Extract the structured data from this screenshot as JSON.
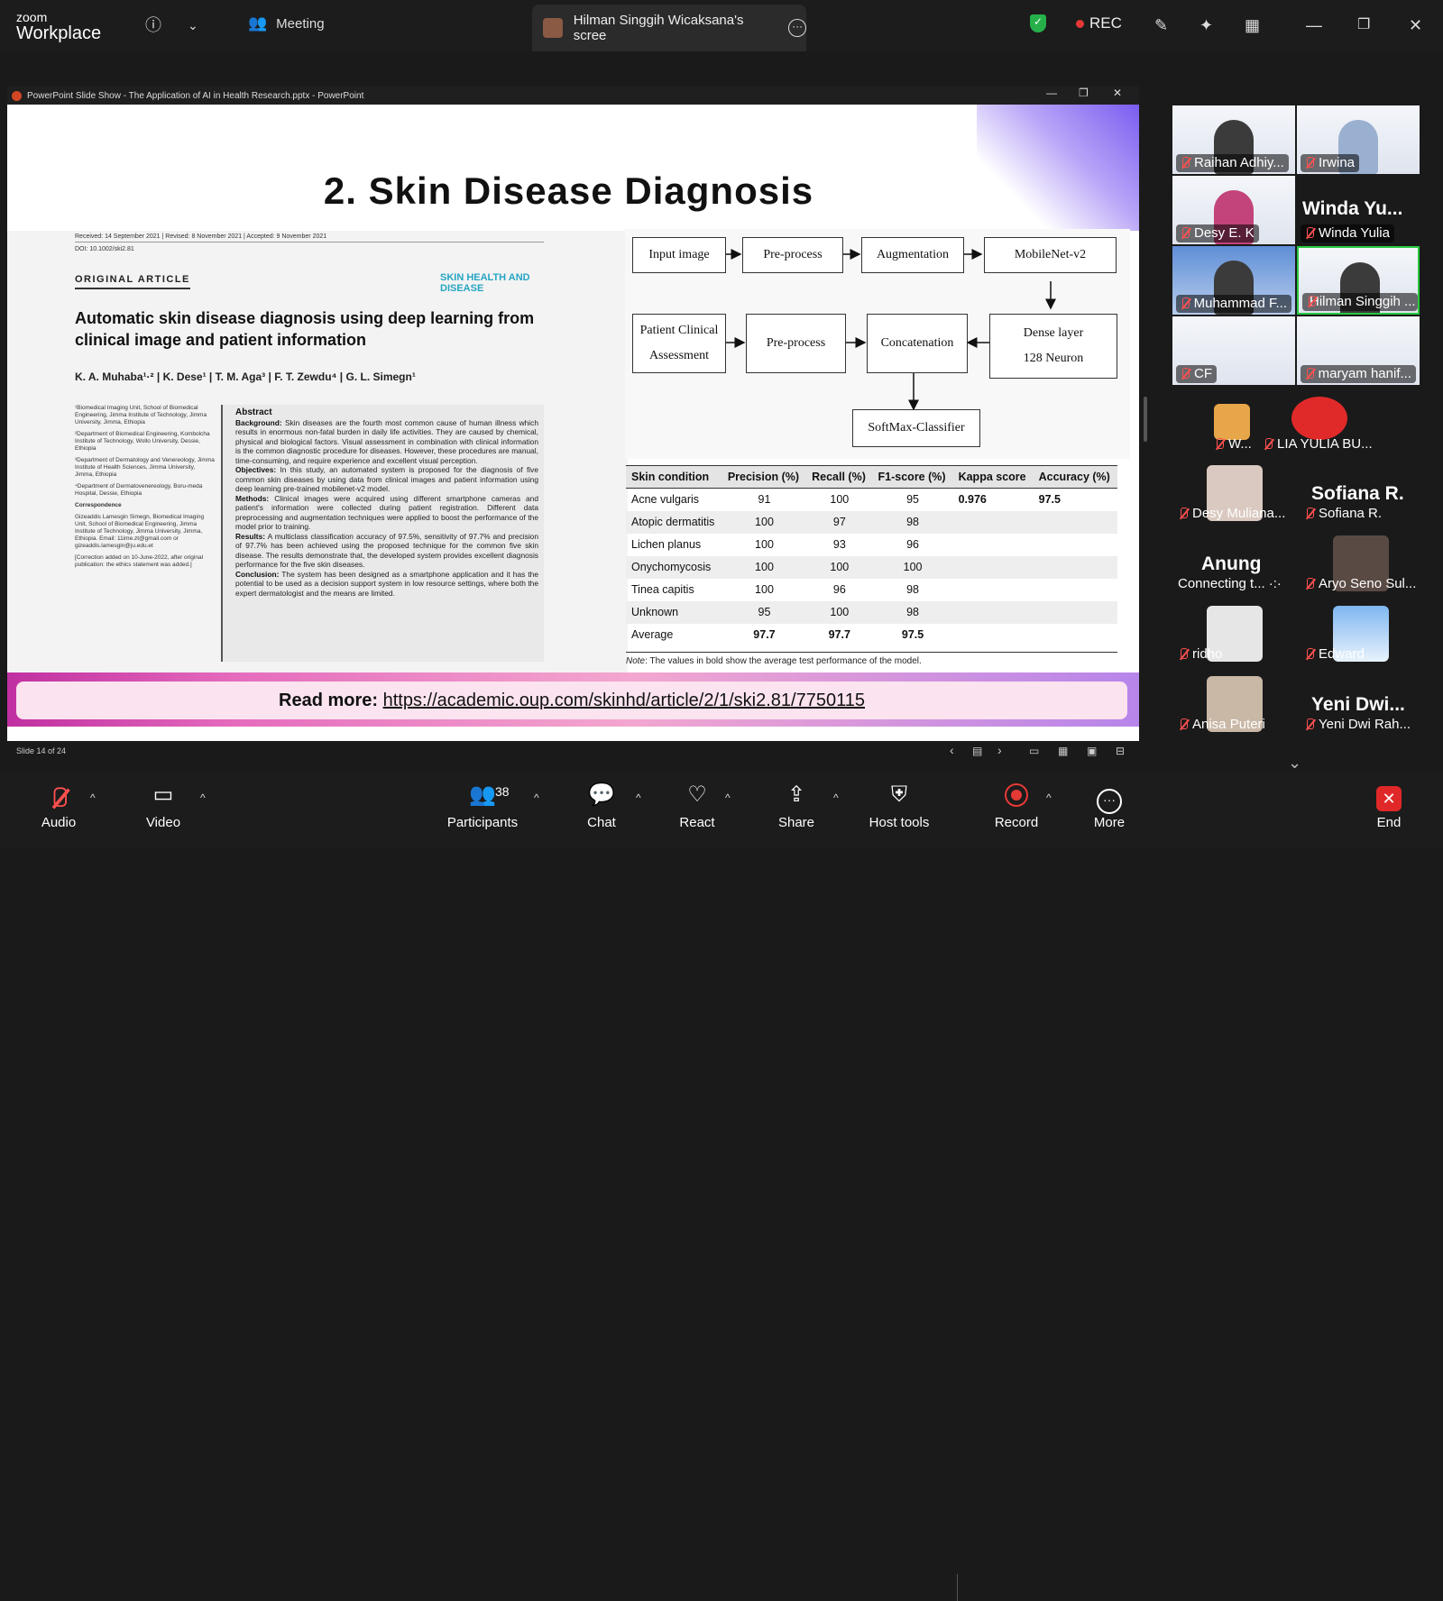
{
  "app": {
    "logo_line1": "zoom",
    "logo_line2": "Workplace"
  },
  "topbar": {
    "meeting_label": "Meeting",
    "share_title": "Hilman Singgih Wicaksana's scree",
    "rec_label": "REC"
  },
  "ppt": {
    "window_title": "PowerPoint Slide Show  -  The Application of AI in Health Research.pptx  -  PowerPoint",
    "slide_status": "Slide 14 of 24"
  },
  "slide": {
    "title": "2. Skin Disease Diagnosis",
    "paper": {
      "dates": "Received: 14 September 2021   |   Revised: 8 November 2021   |   Accepted: 9 November 2021",
      "doi": "DOI: 10.1002/ski2.81",
      "article_type": "ORIGINAL ARTICLE",
      "journal": "SKIN HEALTH AND DISEASE",
      "title": "Automatic skin disease diagnosis using deep learning from clinical image and patient information",
      "authors": "K. A. Muhaba¹·²  |  K. Dese¹  |  T. M. Aga³  |  F. T. Zewdu⁴  |  G. L. Simegn¹",
      "affil1": "¹Biomedical Imaging Unit, School of Biomedical Engineering, Jimma Institute of Technology, Jimma University, Jimma, Ethiopia",
      "affil2": "²Department of Biomedical Engineering, Kombolcha Institute of Technology, Wollo University, Dessie, Ethiopia",
      "affil3": "³Department of Dermatology and Venereology, Jimma Institute of Health Sciences, Jimma University, Jimma, Ethiopia",
      "affil4": "⁴Department of Dermatovenereology, Boru-meda Hospital, Dessie, Ethiopia",
      "correspondence_head": "Correspondence",
      "correspondence": "Gizeaddis Lamesgin Simegn, Biomedical Imaging Unit, School of Biomedical Engineering, Jimma Institute of Technology, Jimma University, Jimma, Ethiopia. Email: 11ime.zt@gmail.com or gizeaddis.lamesgin@ju.edu.et",
      "correction": "[Correction added on 10-June-2022, after original publication: the ethics statement was added.]",
      "abstract_head": "Abstract",
      "bg_head": "Background:",
      "bg_text": "Skin diseases are the fourth most common cause of human illness which results in enormous non-fatal burden in daily life activities. They are caused by chemical, physical and biological factors. Visual assessment in combination with clinical information is the common diagnostic procedure for diseases. However, these procedures are manual, time-consuming, and require experience and excellent visual perception.",
      "obj_head": "Objectives:",
      "obj_text": "In this study, an automated system is proposed for the diagnosis of five common skin diseases by using data from clinical images and patient information using deep learning pre-trained mobilenet-v2 model.",
      "meth_head": "Methods:",
      "meth_text": "Clinical images were acquired using different smartphone cameras and patient's information were collected during patient registration. Different data preprocessing and augmentation techniques were applied to boost the performance of the model prior to training.",
      "res_head": "Results:",
      "res_text": "A multiclass classification accuracy of 97.5%, sensitivity of 97.7% and precision of 97.7% has been achieved using the proposed technique for the common five skin disease. The results demonstrate that, the developed system provides excellent diagnosis performance for the five skin diseases.",
      "conc_head": "Conclusion:",
      "conc_text": "The system has been designed as a smartphone application and it has the potential to be used as a decision support system in low resource settings, where both the expert dermatologist and the means are limited."
    },
    "flow": {
      "input_image": "Input image",
      "preprocess1": "Pre-process",
      "augmentation": "Augmentation",
      "mobilenet": "MobileNet-v2",
      "patient_line1": "Patient Clinical",
      "patient_line2": "Assessment",
      "preprocess2": "Pre-process",
      "concatenation": "Concatenation",
      "dense_line1": "Dense layer",
      "dense_line2": "128 Neuron",
      "softmax": "SoftMax-Classifier"
    },
    "table": {
      "headers": [
        "Skin condition",
        "Precision (%)",
        "Recall (%)",
        "F1-score (%)",
        "Kappa score",
        "Accuracy (%)"
      ],
      "rows": [
        [
          "Acne vulgaris",
          "91",
          "100",
          "95",
          "0.976",
          "97.5"
        ],
        [
          "Atopic dermatitis",
          "100",
          "97",
          "98",
          "",
          ""
        ],
        [
          "Lichen planus",
          "100",
          "93",
          "96",
          "",
          ""
        ],
        [
          "Onychomycosis",
          "100",
          "100",
          "100",
          "",
          ""
        ],
        [
          "Tinea capitis",
          "100",
          "96",
          "98",
          "",
          ""
        ],
        [
          "Unknown",
          "95",
          "100",
          "98",
          "",
          ""
        ],
        [
          "Average",
          "97.7",
          "97.7",
          "97.5",
          "",
          ""
        ]
      ],
      "note_label": "Note",
      "note_text": ": The values in bold show the average test performance of the model."
    },
    "readmore_label": "Read more:",
    "readmore_url": "https://academic.oup.com/skinhd/article/2/1/ski2.81/7750115"
  },
  "gallery": {
    "tiles": [
      "Raihan Adhiy...",
      "Irwina",
      "Desy E. K",
      "Winda Yulia",
      "Muhammad F...",
      "Hilman Singgih ...",
      "CF",
      "maryam hanif..."
    ],
    "winda_big": "Winda Yu...",
    "small": [
      "W...",
      "LIA YULIA BU...",
      "Desy Muliana...",
      "Sofiana R.",
      "Connecting t...",
      "Aryo Seno Sul...",
      "ridho",
      "Edward",
      "Anisa Puteri",
      "Yeni Dwi Rah..."
    ],
    "sofiana_big": "Sofiana R.",
    "anung_big": "Anung",
    "yeni_big": "Yeni Dwi..."
  },
  "toolbar": {
    "audio": "Audio",
    "video": "Video",
    "participants": "Participants",
    "participants_count": "38",
    "chat": "Chat",
    "react": "React",
    "share": "Share",
    "host_tools": "Host tools",
    "record": "Record",
    "more": "More",
    "end": "End"
  },
  "colors": {
    "accent_green": "#28c940",
    "record_red": "#e53935",
    "mute_red": "#ff5050",
    "journal_cyan": "#25a5c3"
  }
}
